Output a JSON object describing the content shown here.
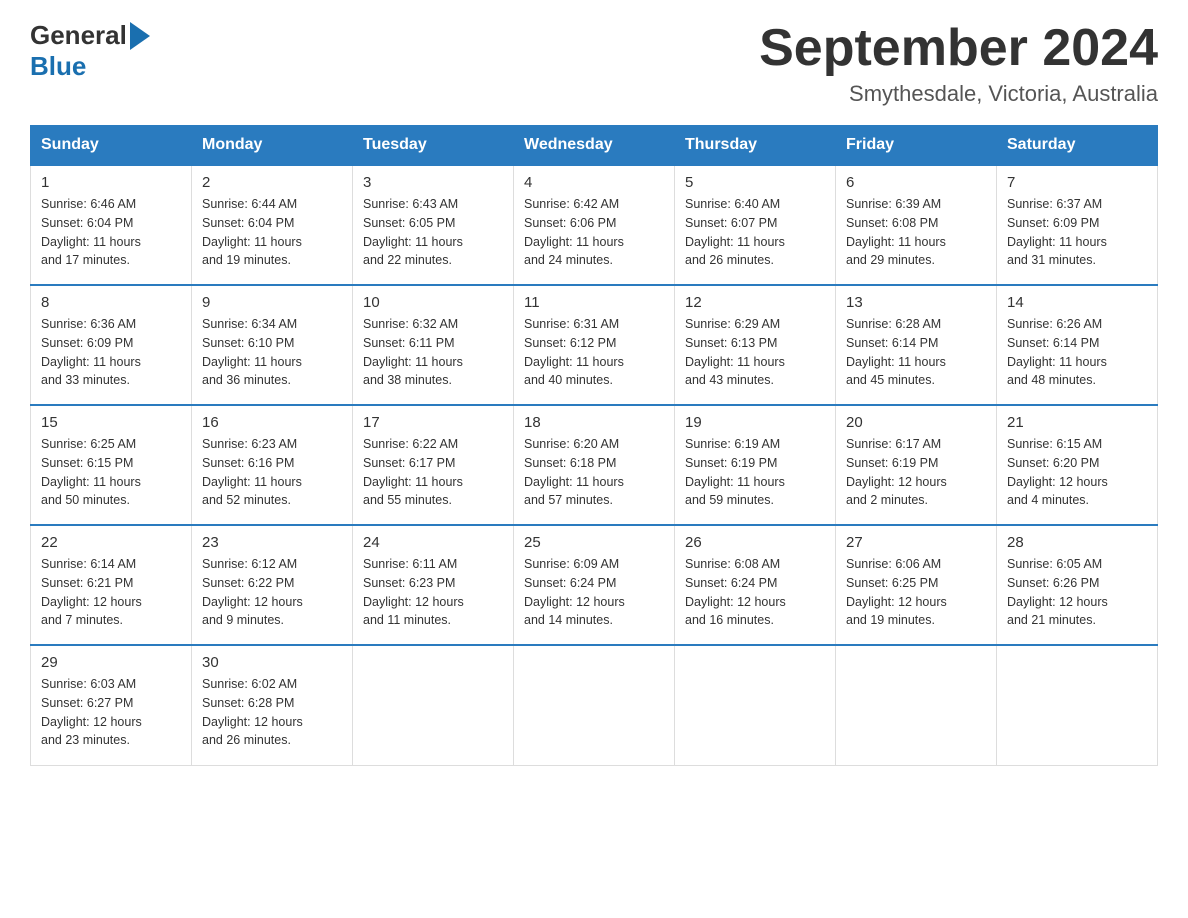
{
  "header": {
    "logo_general": "General",
    "logo_blue": "Blue",
    "month_title": "September 2024",
    "location": "Smythesdale, Victoria, Australia"
  },
  "days_of_week": [
    "Sunday",
    "Monday",
    "Tuesday",
    "Wednesday",
    "Thursday",
    "Friday",
    "Saturday"
  ],
  "weeks": [
    [
      {
        "day": "1",
        "sunrise": "6:46 AM",
        "sunset": "6:04 PM",
        "daylight": "11 hours and 17 minutes."
      },
      {
        "day": "2",
        "sunrise": "6:44 AM",
        "sunset": "6:04 PM",
        "daylight": "11 hours and 19 minutes."
      },
      {
        "day": "3",
        "sunrise": "6:43 AM",
        "sunset": "6:05 PM",
        "daylight": "11 hours and 22 minutes."
      },
      {
        "day": "4",
        "sunrise": "6:42 AM",
        "sunset": "6:06 PM",
        "daylight": "11 hours and 24 minutes."
      },
      {
        "day": "5",
        "sunrise": "6:40 AM",
        "sunset": "6:07 PM",
        "daylight": "11 hours and 26 minutes."
      },
      {
        "day": "6",
        "sunrise": "6:39 AM",
        "sunset": "6:08 PM",
        "daylight": "11 hours and 29 minutes."
      },
      {
        "day": "7",
        "sunrise": "6:37 AM",
        "sunset": "6:09 PM",
        "daylight": "11 hours and 31 minutes."
      }
    ],
    [
      {
        "day": "8",
        "sunrise": "6:36 AM",
        "sunset": "6:09 PM",
        "daylight": "11 hours and 33 minutes."
      },
      {
        "day": "9",
        "sunrise": "6:34 AM",
        "sunset": "6:10 PM",
        "daylight": "11 hours and 36 minutes."
      },
      {
        "day": "10",
        "sunrise": "6:32 AM",
        "sunset": "6:11 PM",
        "daylight": "11 hours and 38 minutes."
      },
      {
        "day": "11",
        "sunrise": "6:31 AM",
        "sunset": "6:12 PM",
        "daylight": "11 hours and 40 minutes."
      },
      {
        "day": "12",
        "sunrise": "6:29 AM",
        "sunset": "6:13 PM",
        "daylight": "11 hours and 43 minutes."
      },
      {
        "day": "13",
        "sunrise": "6:28 AM",
        "sunset": "6:14 PM",
        "daylight": "11 hours and 45 minutes."
      },
      {
        "day": "14",
        "sunrise": "6:26 AM",
        "sunset": "6:14 PM",
        "daylight": "11 hours and 48 minutes."
      }
    ],
    [
      {
        "day": "15",
        "sunrise": "6:25 AM",
        "sunset": "6:15 PM",
        "daylight": "11 hours and 50 minutes."
      },
      {
        "day": "16",
        "sunrise": "6:23 AM",
        "sunset": "6:16 PM",
        "daylight": "11 hours and 52 minutes."
      },
      {
        "day": "17",
        "sunrise": "6:22 AM",
        "sunset": "6:17 PM",
        "daylight": "11 hours and 55 minutes."
      },
      {
        "day": "18",
        "sunrise": "6:20 AM",
        "sunset": "6:18 PM",
        "daylight": "11 hours and 57 minutes."
      },
      {
        "day": "19",
        "sunrise": "6:19 AM",
        "sunset": "6:19 PM",
        "daylight": "11 hours and 59 minutes."
      },
      {
        "day": "20",
        "sunrise": "6:17 AM",
        "sunset": "6:19 PM",
        "daylight": "12 hours and 2 minutes."
      },
      {
        "day": "21",
        "sunrise": "6:15 AM",
        "sunset": "6:20 PM",
        "daylight": "12 hours and 4 minutes."
      }
    ],
    [
      {
        "day": "22",
        "sunrise": "6:14 AM",
        "sunset": "6:21 PM",
        "daylight": "12 hours and 7 minutes."
      },
      {
        "day": "23",
        "sunrise": "6:12 AM",
        "sunset": "6:22 PM",
        "daylight": "12 hours and 9 minutes."
      },
      {
        "day": "24",
        "sunrise": "6:11 AM",
        "sunset": "6:23 PM",
        "daylight": "12 hours and 11 minutes."
      },
      {
        "day": "25",
        "sunrise": "6:09 AM",
        "sunset": "6:24 PM",
        "daylight": "12 hours and 14 minutes."
      },
      {
        "day": "26",
        "sunrise": "6:08 AM",
        "sunset": "6:24 PM",
        "daylight": "12 hours and 16 minutes."
      },
      {
        "day": "27",
        "sunrise": "6:06 AM",
        "sunset": "6:25 PM",
        "daylight": "12 hours and 19 minutes."
      },
      {
        "day": "28",
        "sunrise": "6:05 AM",
        "sunset": "6:26 PM",
        "daylight": "12 hours and 21 minutes."
      }
    ],
    [
      {
        "day": "29",
        "sunrise": "6:03 AM",
        "sunset": "6:27 PM",
        "daylight": "12 hours and 23 minutes."
      },
      {
        "day": "30",
        "sunrise": "6:02 AM",
        "sunset": "6:28 PM",
        "daylight": "12 hours and 26 minutes."
      },
      null,
      null,
      null,
      null,
      null
    ]
  ],
  "labels": {
    "sunrise": "Sunrise:",
    "sunset": "Sunset:",
    "daylight": "Daylight:"
  }
}
